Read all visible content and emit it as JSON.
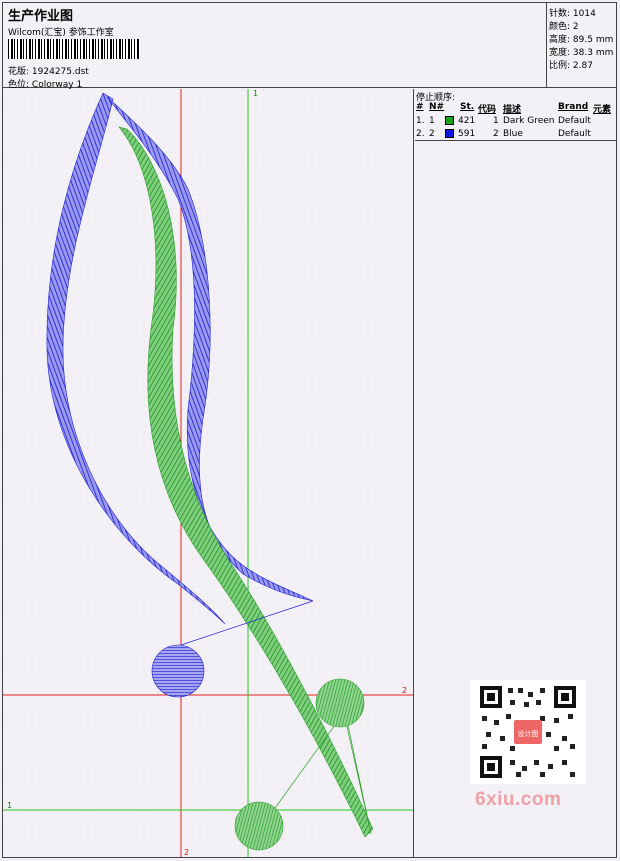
{
  "header": {
    "title": "生产作业图",
    "company": "Wilcom(汇宝) 参饰工作室",
    "design_label": "花版:",
    "design_value": "1924275.dst",
    "colorway_label": "色位:",
    "colorway_value": "Colorway 1"
  },
  "stats": [
    {
      "label": "针数:",
      "value": "1014"
    },
    {
      "label": "颜色:",
      "value": "2"
    },
    {
      "label": "高度:",
      "value": "89.5 mm"
    },
    {
      "label": "宽度:",
      "value": "38.3 mm"
    },
    {
      "label": "比例:",
      "value": "2.87"
    }
  ],
  "guides": {
    "green_vertical": "1",
    "green_horizontal": "1",
    "red_vertical": "2",
    "red_horizontal": "2"
  },
  "stop_sequence": {
    "title": "停止顺序:",
    "headers": {
      "idx": "#",
      "n": "N#",
      "st": "St.",
      "code": "代码",
      "desc": "描述",
      "brand": "Brand",
      "elem": "元素"
    },
    "rows": [
      {
        "idx": "1.",
        "n": "1",
        "st": "421",
        "code": "1",
        "desc": "Dark Green",
        "brand": "Default",
        "color": "#1aa31a"
      },
      {
        "idx": "2.",
        "n": "2",
        "st": "591",
        "code": "2",
        "desc": "Blue",
        "brand": "Default",
        "color": "#1515e0"
      }
    ]
  },
  "colors": {
    "thread_green": "#2e9e2e",
    "thread_blue": "#2424d0",
    "guide_red": "#e02020",
    "guide_green": "#20d020"
  },
  "watermark": "6xiu.com",
  "qr_badge": "设计图"
}
